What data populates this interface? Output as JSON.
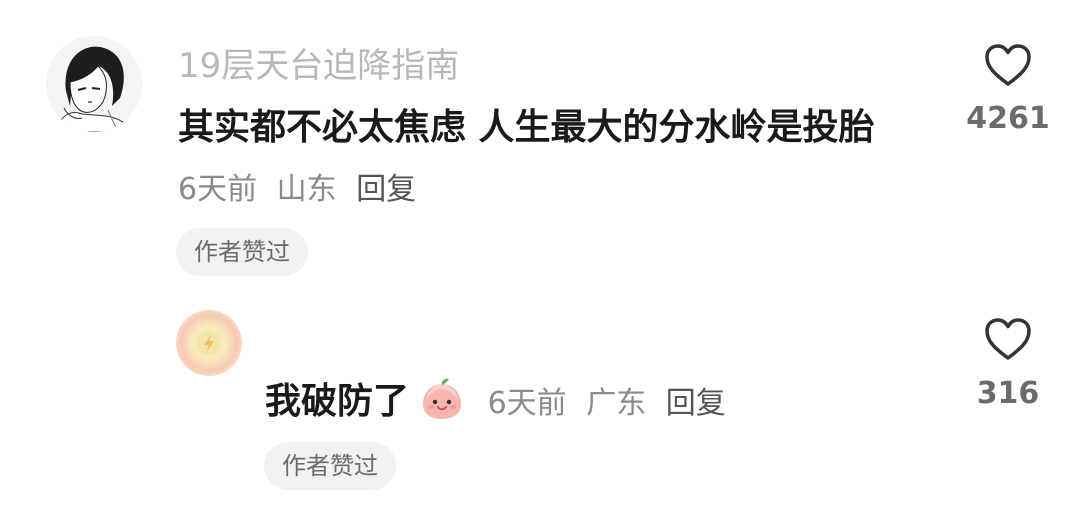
{
  "comment": {
    "username": "19层天台迫降指南",
    "text": "其实都不必太焦虑 人生最大的分水岭是投胎",
    "time": "6天前",
    "location": "山东",
    "reply_label": "回复",
    "author_liked": "作者赞过",
    "likes": "4261"
  },
  "reply": {
    "text": "我破防了",
    "emoji": "peach-bun-emoji",
    "time": "6天前",
    "location": "广东",
    "reply_label": "回复",
    "author_liked": "作者赞过",
    "likes": "316"
  },
  "icons": {
    "like": "heart-outline-icon"
  }
}
